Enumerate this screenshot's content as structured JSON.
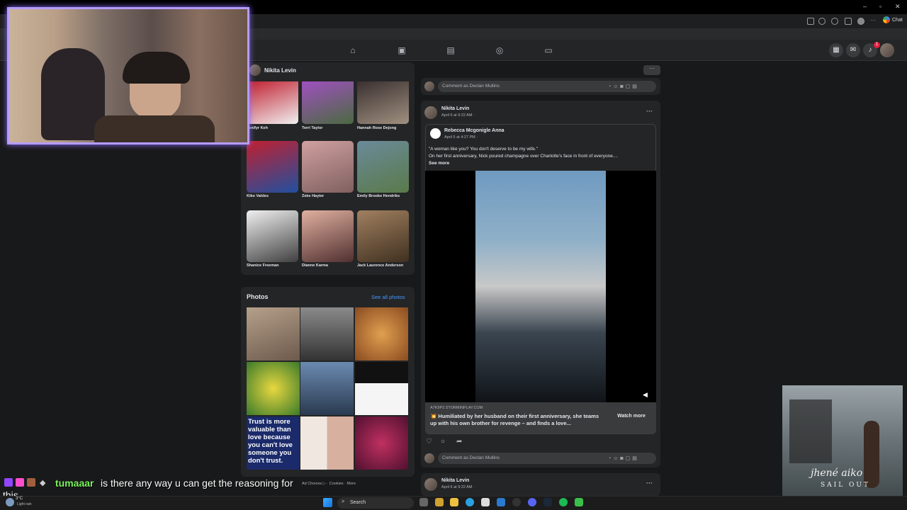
{
  "browser": {
    "window_controls": [
      "–",
      "▫",
      "✕"
    ],
    "chat_button_label": "Chat"
  },
  "facebook": {
    "notification_count": "1",
    "profile": {
      "name": "Nikita Levin"
    },
    "friends": [
      {
        "name": "Jenifyr Keh"
      },
      {
        "name": "Terri Taylor"
      },
      {
        "name": "Hannah Rose Dejong"
      },
      {
        "name": "Kiko Valdes"
      },
      {
        "name": "Zeke Hayter"
      },
      {
        "name": "Emily Brooke Hendriks"
      },
      {
        "name": "Shanice Freeman"
      },
      {
        "name": "Dianne Karma"
      },
      {
        "name": "Jack Laurence Anderson"
      }
    ],
    "photos": {
      "title": "Photos",
      "see_all": "See all photos",
      "tile_text": "Trust is more valuable than love because you can't love someone you don't trust."
    },
    "footer_links": "Ad Choices ▷ · Cookies · More",
    "comment_placeholder": "Comment as Declan Mullins",
    "posts": [
      {
        "author": "Nikita Levin",
        "timestamp": "April 6 at 9:22 AM ·",
        "shared": {
          "author": "Rebecca Mcgonigle Anna",
          "timestamp": "April 5 at 4:27 PM ·",
          "text_line1": "\"A woman like you? You don't deserve to be my wife.\"",
          "text_line2": "On her first anniversary, Nick poured champagne over Charlotte's face in front of everyone....",
          "see_more": "See more"
        },
        "link": {
          "domain": "A7K9P2.STORMINPLAY.COM",
          "title": "💥 Humiliated by her husband on their first anniversary, she teams up with his own brother for revenge – and finds a love...",
          "button": "Watch more"
        }
      },
      {
        "author": "Nikita Levin",
        "timestamp": "April 6 at 9:22 AM ·"
      }
    ]
  },
  "stream_chat": {
    "username": "tumaaar",
    "message_part1": "is there any way u can get the reasoning for",
    "message_part2": "this"
  },
  "album": {
    "artist": "jhené aiko",
    "title": "SAIL OUT"
  },
  "taskbar": {
    "weather_temp": "3°C",
    "weather_desc": "Light rain",
    "search_placeholder": "Search"
  }
}
